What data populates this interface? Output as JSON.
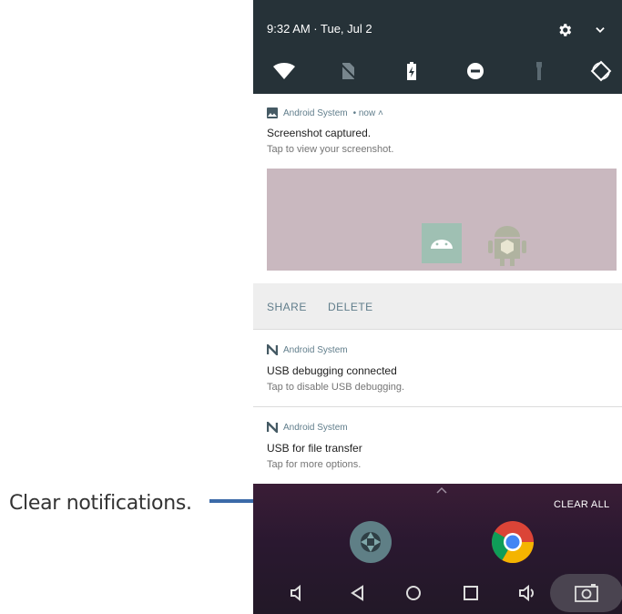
{
  "callout": {
    "label": "Clear notifications."
  },
  "status": {
    "datetime": "9:32 AM · Tue, Jul 2"
  },
  "icons": {
    "settings": "gear-icon",
    "expand": "chevron-down-icon",
    "wifi": "wifi-icon",
    "no_sim": "no-sim-icon",
    "battery": "battery-saver-icon",
    "dnd": "do-not-disturb-icon",
    "flashlight": "flashlight-icon",
    "rotate": "auto-rotate-icon"
  },
  "notifications": [
    {
      "app": "Android System",
      "meta": "• now ˄",
      "title": "Screenshot captured.",
      "text": "Tap to view your screenshot.",
      "actions": [
        "SHARE",
        "DELETE"
      ]
    },
    {
      "app": "Android System",
      "title": "USB debugging connected",
      "text": "Tap to disable USB debugging."
    },
    {
      "app": "Android System",
      "title": "USB for file transfer",
      "text": "Tap for more options."
    }
  ],
  "shade": {
    "clear_all": "CLEAR ALL"
  },
  "colors": {
    "callout_line": "#3b6aa8",
    "shade_bg": "#263238",
    "accent": "#607d8b"
  }
}
